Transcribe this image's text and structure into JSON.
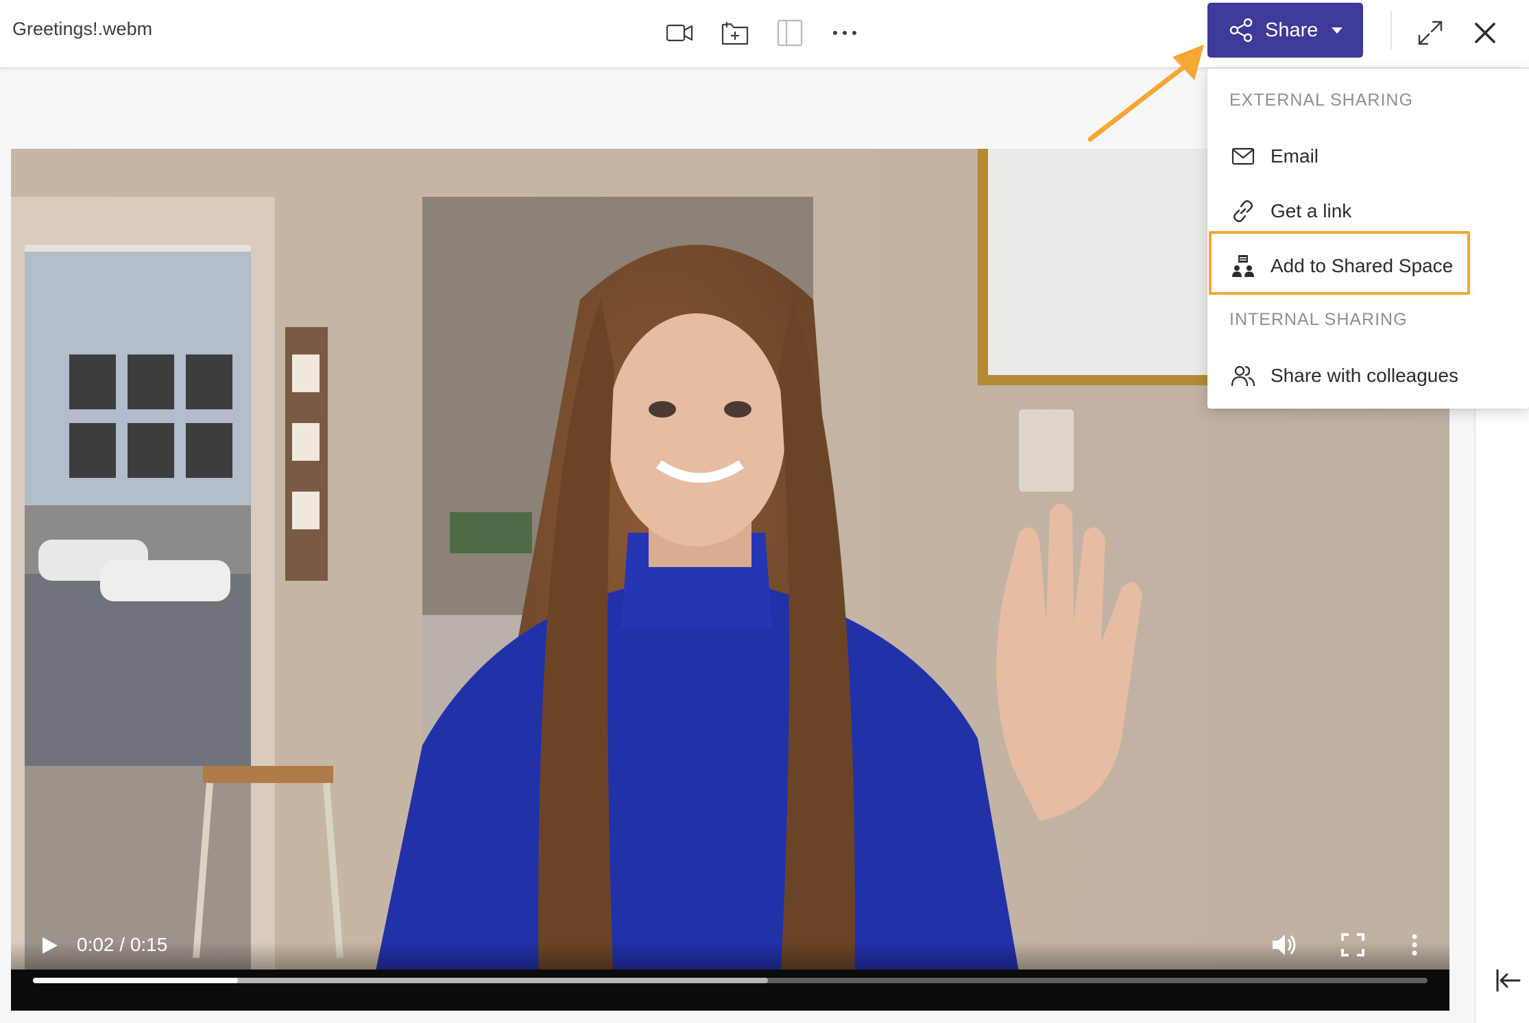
{
  "file": {
    "name": "Greetings!.webm"
  },
  "toolbar": {
    "icons": [
      "video-camera-icon",
      "add-to-folder-icon",
      "panel-layout-icon",
      "more-options-icon",
      "expand-icon",
      "close-icon"
    ]
  },
  "share": {
    "label": "Share",
    "color": "#3d3a9a",
    "menu": {
      "external_heading": "EXTERNAL SHARING",
      "internal_heading": "INTERNAL SHARING",
      "items": [
        {
          "label": "Email",
          "icon": "envelope-icon"
        },
        {
          "label": "Get a link",
          "icon": "link-icon"
        },
        {
          "label": "Add to Shared Space",
          "icon": "shared-space-icon",
          "highlighted": true
        },
        {
          "label": "Share with colleagues",
          "icon": "people-icon"
        }
      ]
    }
  },
  "video": {
    "time": "0:02 / 0:15",
    "progress": 0.147,
    "buffered": 0.527
  },
  "annotations": {
    "highlight_color": "#f4a732"
  }
}
